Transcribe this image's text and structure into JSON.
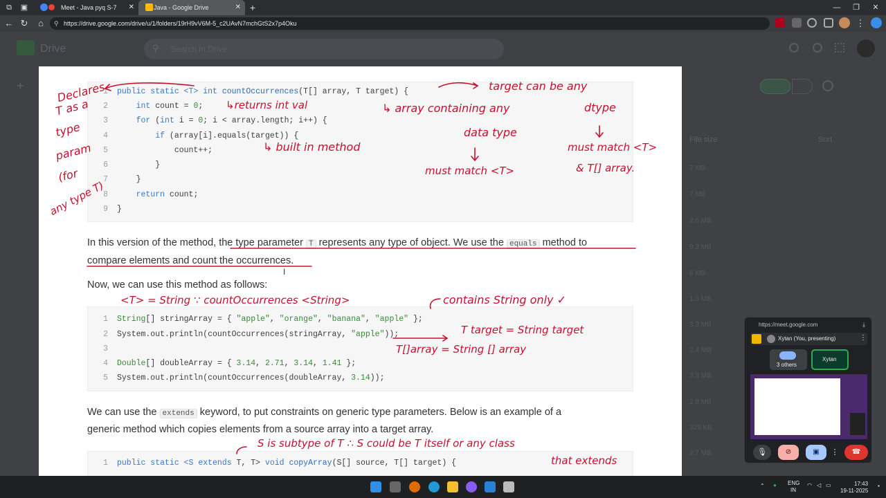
{
  "browser": {
    "tabs": [
      {
        "title": "Meet - Java pyq S-7",
        "active": false
      },
      {
        "title": "Java - Google Drive",
        "active": true
      }
    ],
    "url": "https://drive.google.com/drive/u/1/folders/19rH9vV6M-5_c2UAvN7mchGtS2x7p4Oku"
  },
  "drive": {
    "logo_text": "Drive",
    "search_placeholder": "Search in Drive",
    "column_header": "File size",
    "sort_label": "Sort",
    "sizes": [
      "7 MB",
      "7 MB",
      "2.6 MB",
      "9.3 MB",
      "6 MB",
      "1.6 MB",
      "3.3 MB",
      "2.4 MB",
      "3.3 MB",
      "2.8 MB",
      "329 KB",
      "2.7 MB"
    ]
  },
  "doc": {
    "code1": [
      {
        "n": "1"
      },
      {
        "n": "2"
      },
      {
        "n": "3"
      },
      {
        "n": "4"
      },
      {
        "n": "5"
      },
      {
        "n": "6"
      },
      {
        "n": "7"
      },
      {
        "n": "8"
      },
      {
        "n": "9"
      }
    ],
    "code1_lines": {
      "l1a": "public static <T> ",
      "l1b": "int ",
      "l1c": "countOccurrences",
      "l1d": "(T[] array, T target) {",
      "l2a": "    ",
      "l2b": "int",
      "l2c": " count = ",
      "l2d": "0",
      "l2e": ";",
      "l3a": "    ",
      "l3b": "for",
      "l3c": " (",
      "l3d": "int",
      "l3e": " i = ",
      "l3f": "0",
      "l3g": "; i < array.length; i++) {",
      "l4a": "        ",
      "l4b": "if",
      "l4c": " (array[i].equals(target)) {",
      "l5": "            count++;",
      "l6": "        }",
      "l7": "    }",
      "l8a": "    ",
      "l8b": "return",
      "l8c": " count;",
      "l9": "}"
    },
    "para1_a": "In this version of the method, ",
    "para1_b": "the type parameter ",
    "para1_code1": "T",
    "para1_c": " represents any type of object. We use the ",
    "para1_code2": "equals",
    "para1_d": " method to",
    "para1_e": "compare elements and count the occurrences.",
    "para2": "Now, we can use this method as follows:",
    "code2_nums": [
      "1",
      "2",
      "3",
      "4",
      "5"
    ],
    "code2": {
      "l1a": "String",
      "l1b": "[] stringArray = { ",
      "l1c": "\"apple\"",
      "l1d": ", ",
      "l1e": "\"orange\"",
      "l1f": ", ",
      "l1g": "\"banana\"",
      "l1h": ", ",
      "l1i": "\"apple\"",
      "l1j": " };",
      "l2a": "System.out.println(countOccurrences(stringArray, ",
      "l2b": "\"apple\"",
      "l2c": "));",
      "l4a": "Double",
      "l4b": "[] doubleArray = { ",
      "l4c": "3.14",
      "l4d": ", ",
      "l4e": "2.71",
      "l4f": ", ",
      "l4g": "3.14",
      "l4h": ", ",
      "l4i": "1.41",
      "l4j": " };",
      "l5a": "System.out.println(countOccurrences(doubleArray, ",
      "l5b": "3.14",
      "l5c": "));"
    },
    "para3_a": "We can use the ",
    "para3_code": "extends",
    "para3_b": " keyword, to put constraints on generic type parameters. Below is an example of a",
    "para3_c": "generic method which copies elements from a source array into a target array.",
    "code3_num": "1",
    "code3": {
      "a": "public static <S ",
      "b": "extends",
      "c": " T, T> ",
      "d": "void",
      "e": " ",
      "f": "copyArray",
      "g": "(S[] source, T[] target) {"
    }
  },
  "annotations": {
    "a1": "Declares",
    "a2": "T as a",
    "a3": "type",
    "a4": "param",
    "a5": "(for",
    "a6": "any type T)",
    "a7": "↳returns int val",
    "a8": "target can be any",
    "a9": "↳ array containing any",
    "a10": "dtype",
    "a11": "data type",
    "a12": "must match <T>",
    "a13": "must match <T>",
    "a14": "& T[] array.",
    "a15": "↳ built in method",
    "a16": "<T> = String ∵ countOccurrences <String>",
    "a17": "contains String only ✓",
    "a18": "T target = String target",
    "a19": "T[]array = String [] array",
    "a20": "S is subtype of T ∴ S could be T itself or any class",
    "a21": "that extends"
  },
  "meet": {
    "url": "https://meet.google.com",
    "presenter": "Xytan (You, presenting)",
    "others": "3 others",
    "self_tile": "Xytan"
  },
  "taskbar": {
    "lang1": "ENG",
    "lang2": "IN",
    "time": "17:43",
    "date": "19-11-2025"
  },
  "colors": {
    "annotation": "#c8102e",
    "accent": "#3b78c3"
  }
}
